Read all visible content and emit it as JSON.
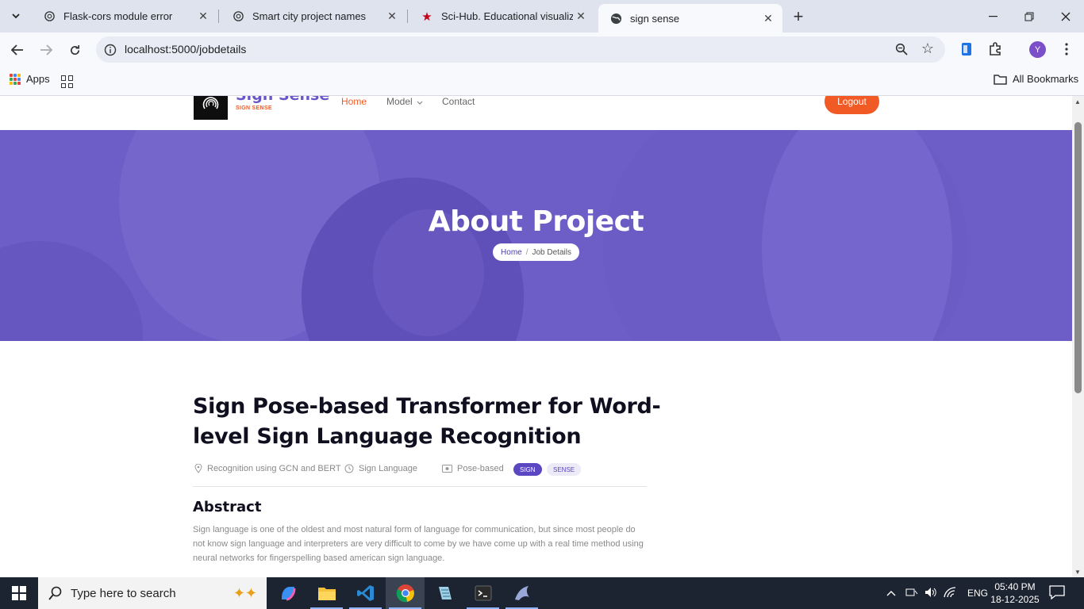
{
  "browser": {
    "tabs": [
      {
        "title": "Flask-cors module error",
        "icon": "openai-icon",
        "active": false
      },
      {
        "title": "Smart city project names",
        "icon": "openai-icon",
        "active": false
      },
      {
        "title": "Sci-Hub. Educational visualization",
        "icon": "scihub-icon",
        "active": false
      },
      {
        "title": "sign sense",
        "icon": "globe-icon",
        "active": true
      }
    ],
    "url": "localhost:5000/jobdetails",
    "profile_initial": "Y",
    "bookmarks": {
      "apps_label": "Apps",
      "all_label": "All Bookmarks"
    }
  },
  "site": {
    "logo_title": "Sign Sense",
    "logo_subtitle": "SIGN SENSE",
    "nav": {
      "home": "Home",
      "model": "Model",
      "contact": "Contact"
    },
    "logout": "Logout"
  },
  "hero": {
    "title": "About Project",
    "breadcrumb_home": "Home",
    "breadcrumb_sep": "/",
    "breadcrumb_current": "Job Details"
  },
  "project": {
    "title": "Sign Pose-based Transformer for Word-level Sign Language Recognition",
    "meta": {
      "location": "Recognition using GCN and BERT",
      "time": "Sign Language",
      "type": "Pose-based"
    },
    "tags": [
      "SIGN",
      "SENSE"
    ],
    "abstract_heading": "Abstract",
    "abstract_text": "Sign language is one of the oldest and most natural form of language for communication, but since most people do not know sign language and interpreters are very difficult to come by we have come up with a real time method using neural networks for fingerspelling based american sign language."
  },
  "taskbar": {
    "search_placeholder": "Type here to search",
    "language": "ENG",
    "time": "05:40 PM",
    "date": "18-12-2025"
  },
  "colors": {
    "accent_orange": "#f15a24",
    "brand_purple": "#6a55c6",
    "hero_bg": "#6c5ec6"
  }
}
